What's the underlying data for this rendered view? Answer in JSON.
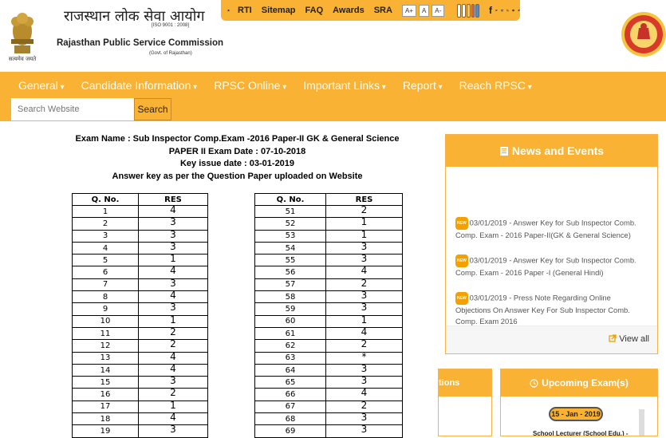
{
  "header": {
    "emblem_caption": "सत्यमेव जयते",
    "org_name_hindi": "राजस्थान लोक सेवा आयोग",
    "iso_text": "[ISO 9001 : 2008]",
    "org_name_english": "Rajasthan Public Service Commission",
    "govt_text": "(Govt. of Rajasthan)"
  },
  "topbar": {
    "links": [
      "RTI",
      "Sitemap",
      "FAQ",
      "Awards",
      "SRA"
    ],
    "font_sizes": [
      "A+",
      "A",
      "A-"
    ],
    "color_swatches": [
      "#ffffff",
      "#ffffff",
      "#f3c46a",
      "#e0664f",
      "#4a8fd4"
    ],
    "social_icons": [
      "facebook-icon",
      "twitter-icon",
      "calendar-icon",
      "rss-icon",
      "globe-icon",
      "pin-icon"
    ]
  },
  "nav": [
    "General",
    "Candidate Information",
    "RPSC Online",
    "Important Links",
    "Report",
    "Reach RPSC"
  ],
  "search": {
    "placeholder": "Search Website",
    "button": "Search"
  },
  "document": {
    "lines": [
      "Exam Name : Sub Inspector Comp.Exam -2016 Paper-II  GK & General Science",
      "PAPER II Exam Date : 07-10-2018",
      "Key issue date : 03-01-2019",
      "Answer key as per the Question Paper uploaded on Website"
    ],
    "col_q": "Q. No.",
    "col_res": "RES",
    "left_rows": [
      [
        "1",
        "4"
      ],
      [
        "2",
        "3"
      ],
      [
        "3",
        "3"
      ],
      [
        "4",
        "3"
      ],
      [
        "5",
        "1"
      ],
      [
        "6",
        "4"
      ],
      [
        "7",
        "3"
      ],
      [
        "8",
        "4"
      ],
      [
        "9",
        "3"
      ],
      [
        "10",
        "1"
      ],
      [
        "11",
        "2"
      ],
      [
        "12",
        "2"
      ],
      [
        "13",
        "4"
      ],
      [
        "14",
        "4"
      ],
      [
        "15",
        "3"
      ],
      [
        "16",
        "2"
      ],
      [
        "17",
        "1"
      ],
      [
        "18",
        "4"
      ],
      [
        "19",
        "3"
      ]
    ],
    "right_rows": [
      [
        "51",
        "2"
      ],
      [
        "52",
        "1"
      ],
      [
        "53",
        "1"
      ],
      [
        "54",
        "3"
      ],
      [
        "55",
        "3"
      ],
      [
        "56",
        "4"
      ],
      [
        "57",
        "2"
      ],
      [
        "58",
        "3"
      ],
      [
        "59",
        "3"
      ],
      [
        "60",
        "1"
      ],
      [
        "61",
        "4"
      ],
      [
        "62",
        "2"
      ],
      [
        "63",
        "*"
      ],
      [
        "64",
        "3"
      ],
      [
        "65",
        "3"
      ],
      [
        "66",
        "4"
      ],
      [
        "67",
        "2"
      ],
      [
        "68",
        "3"
      ],
      [
        "69",
        "3"
      ]
    ]
  },
  "news": {
    "title": "News and Events",
    "badge": "NEW",
    "items": [
      "03/01/2019 - Answer Key for Sub Inspector Comb. Comp. Exam - 2016 Paper-II(GK & General Science)",
      "03/01/2019 - Answer Key for Sub Inspector Comb. Comp. Exam - 2016 Paper -I (General Hindi)",
      "03/01/2019 - Press Note Regarding Online Objections On Answer Key For Sub Inspector Comb. Comp. Exam 2016"
    ],
    "view_all": "View all"
  },
  "notifications": {
    "title_fragment": "tions"
  },
  "upcoming": {
    "title": "Upcoming Exam(s)",
    "date": "15 - Jan - 2019",
    "item": "School Lecturer (School Edu.) -"
  }
}
